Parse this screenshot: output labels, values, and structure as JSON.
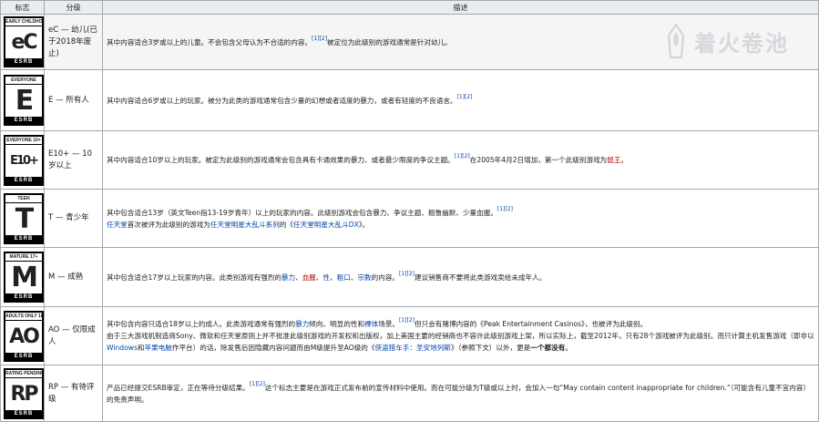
{
  "header": {
    "col_icon": "标志",
    "col_rating": "分级",
    "col_desc": "描述"
  },
  "rows": [
    {
      "badge_top": "EARLY CHILDHOOD",
      "badge_letter": "eC",
      "badge_bottom": "ESRB",
      "rating": "eC — 幼儿(已于2018年废止)",
      "desc1": "其中内容适合3岁或以上的儿童。不会包含父母认为不合适的内容。",
      "sup1": "[1][2]",
      "desc2": "被定位为此级别的游戏通常是针对幼儿。"
    },
    {
      "badge_top": "EVERYONE",
      "badge_letter": "E",
      "badge_bottom": "ESRB",
      "rating": "E — 所有人",
      "desc1": "其中内容适合6岁或以上的玩家。被分为此类的游戏通常包含少量的幻想或者适度的暴力，或者有轻度的不良语言。",
      "sup1": "[1][2]"
    },
    {
      "badge_top": "EVERYONE 10+",
      "badge_letter": "E10+",
      "badge_bottom": "ESRB",
      "rating": "E10+ — 10岁以上",
      "desc1": "其中内容适合10岁以上的玩家。被定为此级别的游戏通常会包含具有卡通效果的暴力、或者最少限度的争议主题。",
      "sup1": "[1][2]",
      "desc2": "在2005年4月2日增加，第一个此级别游戏为",
      "link_red": "鼠王",
      "desc3": "。"
    },
    {
      "badge_top": "TEEN",
      "badge_letter": "T",
      "badge_bottom": "ESRB",
      "rating": "T — 青少年",
      "desc1": "其中包含适合13岁（英文Teen指13-19岁青年）以上的玩家的内容。此级别游戏会包含暴力、争议主题、粗鲁幽默、少量血腥。",
      "sup1": "[1][2]",
      "line2_link1": "任天堂",
      "line2_text1": "首次被评为此级别的游戏为",
      "line2_link2": "任天堂明星大乱斗系列",
      "line2_text2": "的《",
      "line2_link3": "任天堂明星大乱斗DX",
      "line2_text3": "》。"
    },
    {
      "badge_top": "MATURE 17+",
      "badge_letter": "M",
      "badge_bottom": "ESRB",
      "rating": "M — 成熟",
      "desc1": "其中包含适合17岁以上玩家的内容。此类别游戏有强烈的",
      "l1": "暴力",
      "s1": "、",
      "l2": "血腥",
      "s2": "、",
      "l3": "性",
      "s3": "、",
      "l4": "粗口",
      "s4": "、",
      "l5": "宗教",
      "s5": "的内容。",
      "sup1": "[1][2]",
      "desc2": "建议销售商不要将此类游戏卖给未成年人。"
    },
    {
      "badge_top": "ADULTS ONLY 18+",
      "badge_letter": "AO",
      "badge_bottom": "ESRB",
      "rating": "AO — 仅限成人",
      "desc1": "其中包含内容只适合18岁以上的成人。此类游戏通常有强烈的",
      "l1": "暴力",
      "s1": "倾向、明显的性和",
      "l2": "裸体",
      "s2": "场景。",
      "sup1": "[1][2]",
      "desc2": "但只会有赌博内容的《Peak Entertainment Casinos》，也被评为此级别。",
      "p2a": "由于三大游戏机制造商Sony、微软和任天堂原则上并不批准此级别游戏的开发权和出版权，加上美国主要的经销商也不容许此级别游戏上架，所以实际上，截至2012年，只有28个游戏被评为此级别。而只计算主机发售游戏（即非以",
      "p2l1": "Windows",
      "p2b": "和",
      "p2l2": "苹果电脑",
      "p2c": "作平台）的话，除发售后因隐藏内容问题而由M级提升至AO级的《",
      "p2l3": "侠盗猎车手：圣安地列斯",
      "p2d": "》（参照下文）以外，更是",
      "p2bold": "一个都没有",
      "p2e": "。"
    },
    {
      "badge_top": "RATING PENDING",
      "badge_letter": "RP",
      "badge_bottom": "ESRB",
      "rating": "RP — 有待评级",
      "desc1": "产品已经提交ESRB审定，正在等待分级结果。",
      "sup1": "[1][2]",
      "desc2": "这个标志主要是在游戏正式发布前的宣传材料中使用。而在可能分级为T级或以上时，会加入一句“May contain content inappropriate for children.”（可能含有儿童不宜内容）的免责声明。"
    }
  ],
  "watermark": {
    "text": "着火卷池",
    "icon": "flame-tower-icon"
  }
}
